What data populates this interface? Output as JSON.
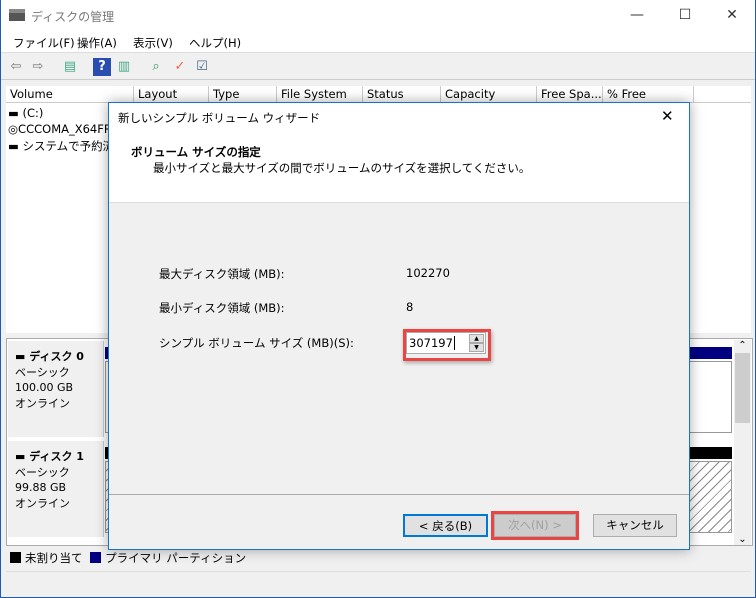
{
  "window": {
    "title": "ディスクの管理",
    "minimize": "—",
    "maximize": "☐",
    "close": "✕"
  },
  "menu": [
    "ファイル(F)",
    "操作(A)",
    "表示(V)",
    "ヘルプ(H)"
  ],
  "toolbar": [
    "back-icon",
    "forward-icon",
    "console-tree-icon",
    "help-icon",
    "action-pane-icon",
    "connect-icon",
    "check-icon",
    "properties-icon"
  ],
  "columns": [
    "Volume",
    "Layout",
    "Type",
    "File System",
    "Status",
    "Capacity",
    "Free Spa...",
    "% Free"
  ],
  "volumes": [
    "(C:)",
    "CCCOMA_X64FR",
    "システムで予約済"
  ],
  "disks": [
    {
      "name": "ディスク 0",
      "type": "ベーシック",
      "size": "100.00 GB",
      "status": "オンライン",
      "bar_color": "#000080"
    },
    {
      "name": "ディスク 1",
      "type": "ベーシック",
      "size": "99.88 GB",
      "status": "オンライン",
      "bar_color": "#000000"
    }
  ],
  "legend": [
    {
      "label": "未割り当て",
      "color": "#000000"
    },
    {
      "label": "プライマリ パーティション",
      "color": "#000080"
    }
  ],
  "dialog": {
    "title": "新しいシンプル ボリューム ウィザード",
    "heading": "ボリューム サイズの指定",
    "subheading": "最小サイズと最大サイズの間でボリュームのサイズを選択してください。",
    "max_label": "最大ディスク領域 (MB):",
    "max_value": "102270",
    "min_label": "最小ディスク領域 (MB):",
    "min_value": "8",
    "size_label": "シンプル ボリューム サイズ (MB)(S):",
    "size_value": "307197",
    "back": "< 戻る(B)",
    "next": "次へ(N) >",
    "cancel": "キャンセル",
    "close": "✕"
  },
  "highlight_color": "#e84545"
}
